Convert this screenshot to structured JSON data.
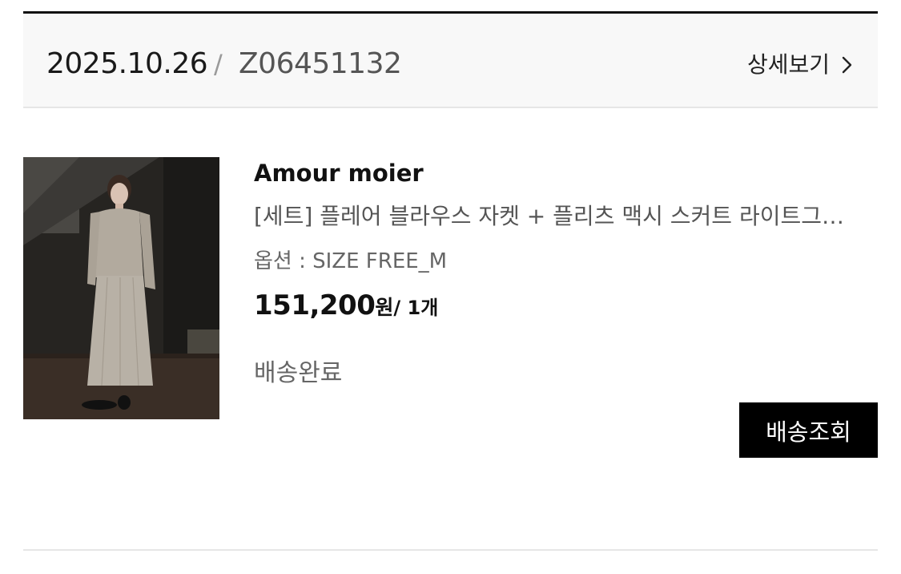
{
  "order": {
    "date": "2025.10.26",
    "separator": "/",
    "number": "Z06451132",
    "detail_label": "상세보기"
  },
  "item": {
    "brand": "Amour moier",
    "name": "[세트] 플레어 블라우스 자켓 + 플리츠 맥시 스커트 라이트그레이",
    "option": "옵션 : SIZE FREE_M",
    "price": "151,200",
    "price_unit": "원",
    "quantity": "/ 1개",
    "status": "배송완료",
    "track_label": "배송조회"
  }
}
